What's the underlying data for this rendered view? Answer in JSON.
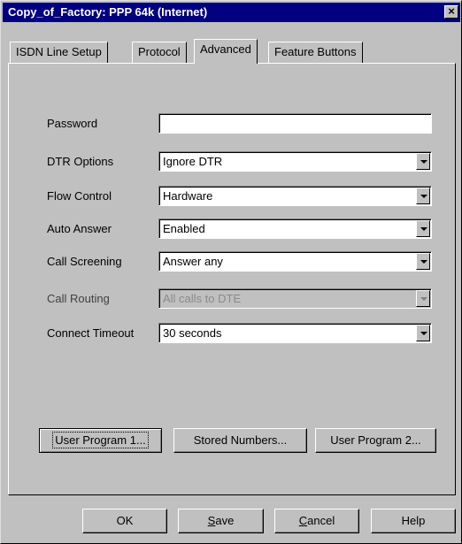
{
  "window": {
    "title": "Copy_of_Factory: PPP 64k (Internet)",
    "close_glyph": "×"
  },
  "tabs": [
    {
      "label": "ISDN Line Setup",
      "active": false
    },
    {
      "label": "Protocol",
      "active": false
    },
    {
      "label": "Advanced",
      "active": true
    },
    {
      "label": "Feature Buttons",
      "active": false
    }
  ],
  "form": {
    "password": {
      "label": "Password",
      "value": ""
    },
    "dtr_options": {
      "label": "DTR Options",
      "value": "Ignore DTR"
    },
    "flow_control": {
      "label": "Flow Control",
      "value": "Hardware"
    },
    "auto_answer": {
      "label": "Auto Answer",
      "value": "Enabled"
    },
    "call_screening": {
      "label": "Call Screening",
      "value": "Answer any"
    },
    "call_routing": {
      "label": "Call Routing",
      "value": "All calls to DTE",
      "disabled": true
    },
    "connect_timeout": {
      "label": "Connect Timeout",
      "value": "30 seconds"
    }
  },
  "panel_buttons": {
    "user_program_1": "User Program 1...",
    "stored_numbers": "Stored Numbers...",
    "user_program_2": "User Program 2..."
  },
  "dialog_buttons": {
    "ok": "OK",
    "save_accel": "S",
    "save_rest": "ave",
    "cancel_accel": "C",
    "cancel_rest": "ancel",
    "help": "Help"
  },
  "colors": {
    "titlebar": "#000080",
    "face": "#c0c0c0"
  },
  "icons": {
    "close": "close-icon",
    "dropdown": "chevron-down-icon"
  }
}
